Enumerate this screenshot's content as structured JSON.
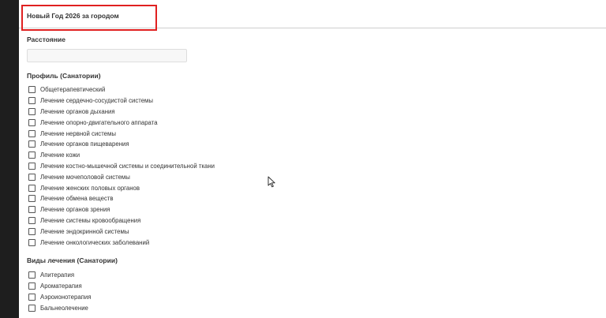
{
  "header": {
    "title": "Новый Год 2026 за городом"
  },
  "distance": {
    "label": "Расстояние",
    "value": ""
  },
  "profile": {
    "label": "Профиль (Санатории)",
    "items": [
      "Общетерапевтический",
      "Лечение сердечно-сосудистой системы",
      "Лечение органов дыхания",
      "Лечение опорно-двигательного аппарата",
      "Лечение нервной системы",
      "Лечение органов пищеварения",
      "Лечение кожи",
      "Лечение костно-мышечной системы и соединительной ткани",
      "Лечение мочеполовой системы",
      "Лечение женских половых органов",
      "Лечение обмена веществ",
      "Лечение органов зрения",
      "Лечение системы кровообращения",
      "Лечение эндокринной системы",
      "Лечение онкологических заболеваний"
    ]
  },
  "treatment": {
    "label": "Виды лечения (Санатории)",
    "items": [
      "Апитерапия",
      "Ароматерапия",
      "Аэроионотерапия",
      "Бальнеолечение"
    ]
  },
  "colors": {
    "highlight": "#e02020",
    "text": "#333333",
    "background": "#ffffff",
    "frame": "#1e1e1e"
  },
  "cursor": "mouse-pointer-icon"
}
